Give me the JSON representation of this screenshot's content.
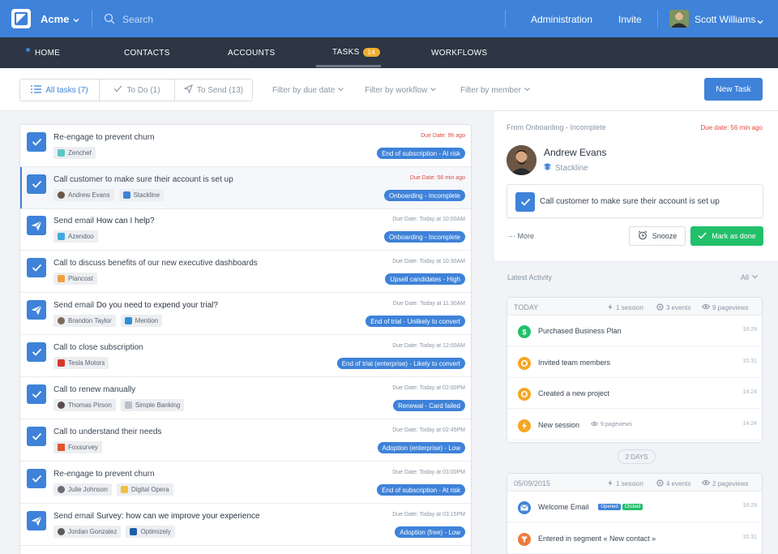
{
  "topbar": {
    "brand": "Acme",
    "search_placeholder": "Search",
    "links": [
      "Administration",
      "Invite"
    ],
    "user_name": "Scott Williams"
  },
  "nav": {
    "items": [
      "HOME",
      "CONTACTS",
      "ACCOUNTS",
      "TASKS",
      "WORKFLOWS"
    ],
    "tasks_badge": "14"
  },
  "filters": {
    "tabs": [
      "All tasks (7)",
      "To Do (1)",
      "To Send (13)"
    ],
    "dropdowns": [
      "Filter by due date",
      "Filter by workflow",
      "Filter by member"
    ],
    "new_task": "New Task"
  },
  "tasks": [
    {
      "type": "call",
      "title": "Re-engage to prevent churn",
      "bold": "",
      "tags": [
        "Zenchef"
      ],
      "due": "Due Date: 9h ago",
      "overdue": true,
      "workflow": "End of subscription - At risk"
    },
    {
      "type": "call",
      "title": "Call customer to make sure their account is set up",
      "bold": "",
      "tags": [
        "Andrew Evans",
        "Stackline"
      ],
      "due": "Due Date: 56 min ago",
      "overdue": true,
      "workflow": "Onboarding - Incomplete"
    },
    {
      "type": "email",
      "title": "Send email ",
      "bold": "How can I help?",
      "tags": [
        "Azendoo"
      ],
      "due": "Due Date: Today at 10:00AM",
      "overdue": false,
      "workflow": "Onboarding - Incomplete"
    },
    {
      "type": "call",
      "title": "Call to discuss benefits of our new executive dashboards",
      "bold": "",
      "tags": [
        "Plancost"
      ],
      "due": "Due Date: Today at 10:30AM",
      "overdue": false,
      "workflow": "Upsell candidates - High"
    },
    {
      "type": "email",
      "title": "Send email ",
      "bold": "Do you need to expend your trial?",
      "tags": [
        "Brandon Taylor",
        "Mention"
      ],
      "due": "Due Date: Today at 11:30AM",
      "overdue": false,
      "workflow": "End of trial - Unlikely to convert"
    },
    {
      "type": "call",
      "title": "Call to close subscription",
      "bold": "",
      "tags": [
        "Tesla Motors"
      ],
      "due": "Due Date: Today at 12:00AM",
      "overdue": false,
      "workflow": "End of trial (enterprise) - Likely to convert"
    },
    {
      "type": "call",
      "title": "Call to renew manually",
      "bold": "",
      "tags": [
        "Thomas Pirson",
        "Simple Banking"
      ],
      "due": "Due Date: Today at 02:00PM",
      "overdue": false,
      "workflow": "Renewal - Card failed"
    },
    {
      "type": "call",
      "title": "Call to understand their needs",
      "bold": "",
      "tags": [
        "Foxsurvey"
      ],
      "due": "Due Date: Today at 02:45PM",
      "overdue": false,
      "workflow": "Adoption (enterprise) - Low"
    },
    {
      "type": "call",
      "title": "Re-engage to prevent churn",
      "bold": "",
      "tags": [
        "Julie Johnson",
        "Digital Opera"
      ],
      "due": "Due Date: Today at 03:00PM",
      "overdue": false,
      "workflow": "End of subscription - At risk"
    },
    {
      "type": "email",
      "title": "Send email ",
      "bold": "Survey: how can we improve your experience",
      "tags": [
        "Jordan Gonzalez",
        "Optimizely"
      ],
      "due": "Due Date: Today at 03:15PM",
      "overdue": false,
      "workflow": "Adoption (free) - Low"
    }
  ],
  "detail": {
    "from": "From Onboarding - Incomplete",
    "due": "Due date: 56 min ago",
    "contact_name": "Andrew Evans",
    "company": "Stackline",
    "task_title": "Call customer to make sure their account is set up",
    "more": "More",
    "snooze": "Snooze",
    "mark_done": "Mark as done"
  },
  "activity": {
    "heading": "Latest Activity",
    "filter": "All",
    "today": {
      "label": "TODAY",
      "sessions": "1 session",
      "events": "3 events",
      "pageviews": "9 pageviews",
      "items": [
        {
          "text": "Purchased Business Plan",
          "time": "16:29",
          "color": "#22c06a",
          "icon": "dollar"
        },
        {
          "text": "Invited team members",
          "time": "15:31",
          "color": "#f5a623",
          "icon": "ring"
        },
        {
          "text": "Created a new project",
          "time": "14:24",
          "color": "#f5a623",
          "icon": "ring"
        },
        {
          "text": "New session",
          "sub": "9 pageviews",
          "time": "14:24",
          "color": "#f5a623",
          "icon": "bolt"
        }
      ]
    },
    "gap": "2 DAYS",
    "older": {
      "label": "05/09/2015",
      "sessions": "1 session",
      "events": "4 events",
      "pageviews": "2 pageviews",
      "items": [
        {
          "text": "Welcome Email",
          "time": "16:29",
          "color": "#3e82d9",
          "icon": "mail",
          "badges": [
            "Opened",
            "Clicked"
          ]
        },
        {
          "text": "Entered in segment « New contact »",
          "time": "15:31",
          "color": "#f0793e",
          "icon": "funnel"
        }
      ]
    }
  }
}
